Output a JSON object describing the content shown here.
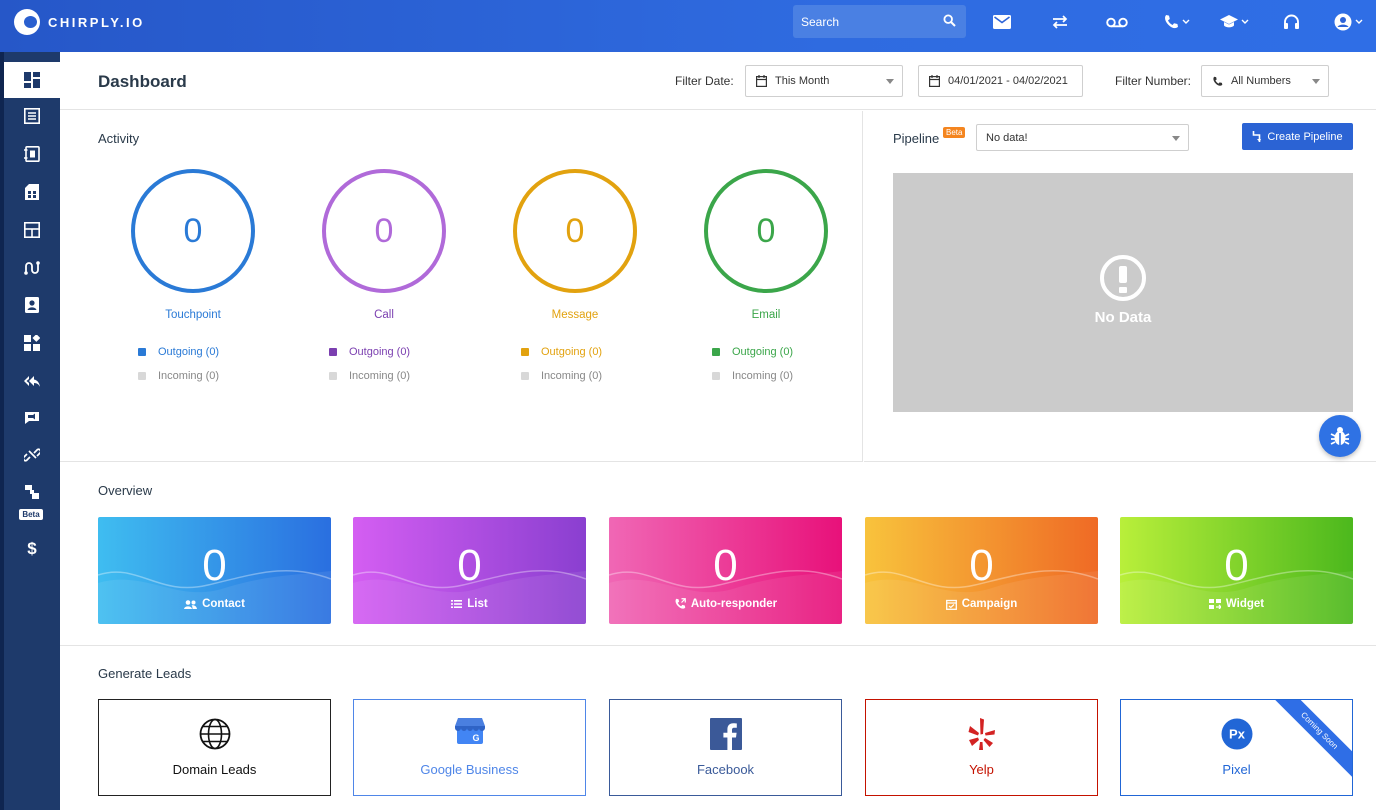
{
  "brand": {
    "name": "CHIRPLY.IO"
  },
  "topbar": {
    "search_placeholder": "Search"
  },
  "sidebar": {
    "beta_label": "Beta"
  },
  "header": {
    "title": "Dashboard",
    "filter_date_label": "Filter Date:",
    "filter_date_value": "This Month",
    "date_range": "04/01/2021 - 04/02/2021",
    "filter_number_label": "Filter Number:",
    "filter_number_value": "All Numbers"
  },
  "activity": {
    "title": "Activity",
    "metrics": [
      {
        "label": "Touchpoint",
        "value": "0",
        "color": "#2a7ad6",
        "outgoing": "Outgoing",
        "outgoing_count": "(0)",
        "incoming": "Incoming",
        "incoming_count": "(0)"
      },
      {
        "label": "Call",
        "value": "0",
        "color": "#b06ad9",
        "swatch": "#7b3fb0",
        "outgoing": "Outgoing",
        "outgoing_count": "(0)",
        "incoming": "Incoming",
        "incoming_count": "(0)"
      },
      {
        "label": "Message",
        "value": "0",
        "color": "#e2a20f",
        "outgoing": "Outgoing",
        "outgoing_count": "(0)",
        "incoming": "Incoming",
        "incoming_count": "(0)"
      },
      {
        "label": "Email",
        "value": "0",
        "color": "#3ba64a",
        "outgoing": "Outgoing",
        "outgoing_count": "(0)",
        "incoming": "Incoming",
        "incoming_count": "(0)"
      }
    ]
  },
  "pipeline": {
    "title": "Pipeline",
    "badge": "Beta",
    "select_value": "No data!",
    "create_button": "Create Pipeline",
    "empty_text": "No Data"
  },
  "overview": {
    "title": "Overview",
    "cards": [
      {
        "value": "0",
        "label": "Contact",
        "icon": "contacts-icon",
        "gradient": [
          "#3fbdf0",
          "#2a6fe0"
        ]
      },
      {
        "value": "0",
        "label": "List",
        "icon": "list-icon",
        "gradient": [
          "#d45ef2",
          "#8a3fd0"
        ]
      },
      {
        "value": "0",
        "label": "Auto-responder",
        "icon": "phone-forward-icon",
        "gradient": [
          "#f067b5",
          "#e8117a"
        ]
      },
      {
        "value": "0",
        "label": "Campaign",
        "icon": "calendar-check-icon",
        "gradient": [
          "#f8c33c",
          "#ef6a25"
        ]
      },
      {
        "value": "0",
        "label": "Widget",
        "icon": "widget-icon",
        "gradient": [
          "#b9ef3a",
          "#4cb81d"
        ]
      }
    ]
  },
  "leads": {
    "title": "Generate Leads",
    "items": [
      {
        "label": "Domain Leads",
        "icon": "globe-icon",
        "color": "#111111"
      },
      {
        "label": "Google Business",
        "icon": "google-business-icon",
        "color": "#4f86e8"
      },
      {
        "label": "Facebook",
        "icon": "facebook-icon",
        "color": "#3a5a99"
      },
      {
        "label": "Yelp",
        "icon": "yelp-icon",
        "color": "#c41200"
      },
      {
        "label": "Pixel",
        "icon": "pixel-icon",
        "color": "#2166d6",
        "ribbon": "Coming Soon"
      }
    ]
  }
}
